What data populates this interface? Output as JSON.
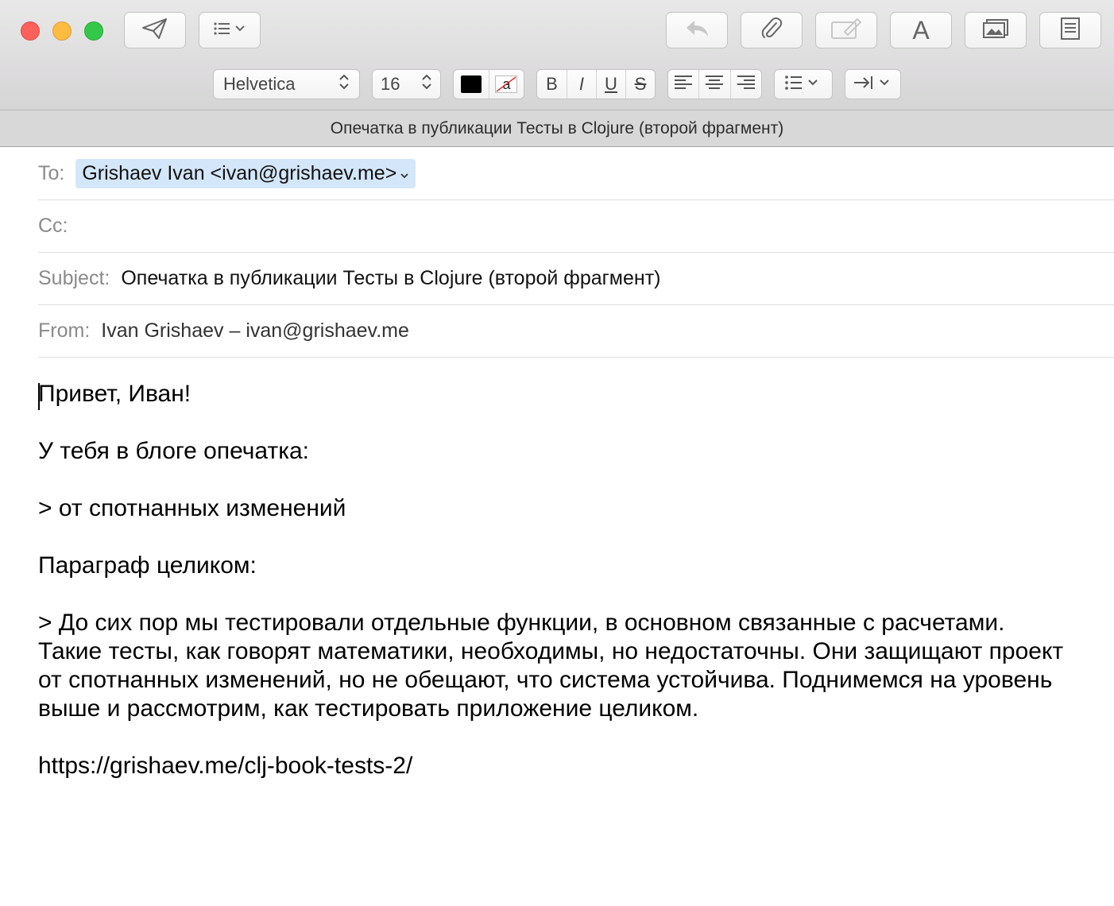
{
  "window": {
    "title": "Опечатка в публикации Тесты в Clojure (второй фрагмент)"
  },
  "toolbar": {
    "send": "paper-plane-icon",
    "header_fields": "list-icon",
    "reply": "reply-arrow-icon",
    "attach": "paperclip-icon",
    "markup": "signature-icon",
    "fonts_label": "A",
    "photo": "photo-browser-icon",
    "stationery": "stationery-icon"
  },
  "format_bar": {
    "font": "Helvetica",
    "size": "16",
    "text_color": "#000000",
    "highlight_label": "a",
    "bold": "B",
    "italic": "I",
    "underline": "U",
    "strike": "S"
  },
  "fields": {
    "to_label": "To:",
    "to_value": "Grishaev Ivan <ivan@grishaev.me>",
    "cc_label": "Cc:",
    "cc_value": "",
    "subject_label": "Subject:",
    "subject_value": "Опечатка в публикации Тесты в Clojure (второй фрагмент)",
    "from_label": "From:",
    "from_value": "Ivan Grishaev – ivan@grishaev.me"
  },
  "body": {
    "greeting": "Привет, Иван!",
    "line1": "У тебя в блоге опечатка:",
    "quote1": "> от спотнанных изменений",
    "line2": "Параграф целиком:",
    "quote2": "> До сих пор мы тестировали отдельные функции, в основном связанные с расчетами. Такие тесты, как говорят математики, необходимы, но недостаточны. Они защищают проект от спотнанных изменений, но не обещают, что система устойчива. Поднимемся на уровень выше и рассмотрим, как тестировать приложение целиком.",
    "link": "https://grishaev.me/clj-book-tests-2/"
  }
}
